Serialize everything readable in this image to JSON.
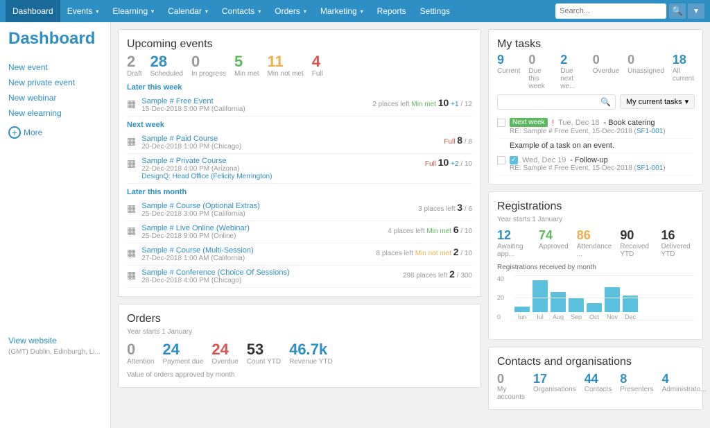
{
  "nav": {
    "items": [
      {
        "label": "Dashboard",
        "active": true
      },
      {
        "label": "Events",
        "dropdown": true
      },
      {
        "label": "Elearning",
        "dropdown": true
      },
      {
        "label": "Calendar",
        "dropdown": true
      },
      {
        "label": "Contacts",
        "dropdown": true
      },
      {
        "label": "Orders",
        "dropdown": true
      },
      {
        "label": "Marketing",
        "dropdown": true
      },
      {
        "label": "Reports",
        "dropdown": false
      },
      {
        "label": "Settings",
        "dropdown": false
      }
    ],
    "search_placeholder": "Search..."
  },
  "sidebar": {
    "title": "Dashboard",
    "links": [
      {
        "label": "New event"
      },
      {
        "label": "New private event"
      },
      {
        "label": "New webinar"
      },
      {
        "label": "New elearning"
      }
    ],
    "more_label": "More",
    "footer": "(GMT) Dublin, Edinburgh, Li..."
  },
  "upcoming_events": {
    "title": "Upcoming events",
    "stats": [
      {
        "number": "2",
        "label": "Draft",
        "color": "gray"
      },
      {
        "number": "28",
        "label": "Scheduled",
        "color": "blue"
      },
      {
        "number": "0",
        "label": "In progress",
        "color": "gray"
      },
      {
        "number": "5",
        "label": "Min met",
        "color": "green"
      },
      {
        "number": "11",
        "label": "Min not met",
        "color": "orange"
      },
      {
        "number": "4",
        "label": "Full",
        "color": "red"
      }
    ],
    "sections": [
      {
        "header": "Later this week",
        "events": [
          {
            "name": "Sample # Free Event",
            "datetime": "15-Dec-2018 5:00 PM (California)",
            "status": "",
            "places_text": "2 places left",
            "status_label": "Min met",
            "status_color": "green",
            "count": "10",
            "plus": "+1",
            "total": "12"
          }
        ]
      },
      {
        "header": "Next week",
        "events": [
          {
            "name": "Sample # Paid Course",
            "datetime": "20-Dec-2018 1:00 PM (Chicago)",
            "status_label": "Full",
            "status_color": "red",
            "count": "8",
            "plus": "",
            "total": "8",
            "places_text": ""
          },
          {
            "name": "Sample # Private Course",
            "datetime": "22-Dec-2018 4:00 PM (Arizona)",
            "location": "DesignQ: Head Office (Felicity Merrington)",
            "status_label": "Full",
            "status_color": "red",
            "count": "10",
            "plus": "+2",
            "total": "10",
            "places_text": ""
          }
        ]
      },
      {
        "header": "Later this month",
        "events": [
          {
            "name": "Sample # Course (Optional Extras)",
            "datetime": "25-Dec-2018 3:00 PM (California)",
            "places_text": "3 places left",
            "status_label": "",
            "count": "3",
            "total": "6"
          },
          {
            "name": "Sample # Live Online (Webinar)",
            "datetime": "25-Dec-2018 9:00 PM (Online)",
            "places_text": "4 places left",
            "status_label": "Min met",
            "status_color": "green",
            "count": "6",
            "total": "10"
          },
          {
            "name": "Sample # Course (Multi-Session)",
            "datetime": "27-Dec-2018 1:00 AM (California)",
            "places_text": "8 places left",
            "status_label": "Min not met",
            "status_color": "orange",
            "count": "2",
            "total": "10"
          },
          {
            "name": "Sample # Conference (Choice Of Sessions)",
            "datetime": "28-Dec-2018 4:00 PM (Chicago)",
            "places_text": "298 places left",
            "count": "2",
            "total": "300"
          }
        ]
      }
    ]
  },
  "orders": {
    "title": "Orders",
    "subtitle": "Year starts 1 January",
    "stats": [
      {
        "number": "0",
        "label": "Attention",
        "color": "gray"
      },
      {
        "number": "24",
        "label": "Payment due",
        "color": "blue"
      },
      {
        "number": "24",
        "label": "Overdue",
        "color": "red"
      },
      {
        "number": "53",
        "label": "Count YTD",
        "color": "dark"
      },
      {
        "number": "46.7k",
        "label": "Revenue YTD",
        "color": "blue"
      }
    ],
    "chart_note": "Value of orders approved by month"
  },
  "my_tasks": {
    "title": "My tasks",
    "stats": [
      {
        "number": "9",
        "label": "Current",
        "color": "blue"
      },
      {
        "number": "0",
        "label": "Due this week",
        "color": "gray"
      },
      {
        "number": "2",
        "label": "Due next we...",
        "color": "blue"
      },
      {
        "number": "0",
        "label": "Overdue",
        "color": "gray"
      },
      {
        "number": "0",
        "label": "Unassigned",
        "color": "gray"
      },
      {
        "number": "18",
        "label": "All current",
        "color": "blue"
      }
    ],
    "filter_label": "My current tasks",
    "tasks": [
      {
        "week_label": "Next week",
        "date": "Tue, Dec 18",
        "title": "- Book catering",
        "sub": "RE: Sample # Free Event, 15-Dec-2018 (SF1-001)",
        "has_alert": true
      },
      {
        "title": "Example of a task on an event.",
        "sub": "",
        "has_alert": false
      },
      {
        "date": "Wed, Dec 19",
        "title": "- Follow-up",
        "sub": "RE: Sample # Free Event, 15-Dec-2018 (SF1-001)",
        "has_alert": false
      }
    ]
  },
  "registrations": {
    "title": "Registrations",
    "subtitle": "Year starts 1 January",
    "stats": [
      {
        "number": "12",
        "label": "Awaiting app...",
        "color": "blue"
      },
      {
        "number": "74",
        "label": "Approved",
        "color": "green"
      },
      {
        "number": "86",
        "label": "Attendance ...",
        "color": "orange"
      },
      {
        "number": "90",
        "label": "Received YTD",
        "color": "dark"
      },
      {
        "number": "16",
        "label": "Delivered YTD",
        "color": "dark"
      }
    ],
    "chart_title": "Registrations received by month",
    "chart_max": 40,
    "chart_bars": [
      {
        "label": "Iun",
        "value": 5
      },
      {
        "label": "Iul",
        "value": 28
      },
      {
        "label": "Aug",
        "value": 18
      },
      {
        "label": "Sep",
        "value": 12
      },
      {
        "label": "Oct",
        "value": 8
      },
      {
        "label": "Nov",
        "value": 22
      },
      {
        "label": "Dec",
        "value": 15
      }
    ]
  },
  "contacts": {
    "title": "Contacts and organisations",
    "stats": [
      {
        "number": "0",
        "label": "My accounts",
        "color": "gray"
      },
      {
        "number": "17",
        "label": "Organisations",
        "color": "blue"
      },
      {
        "number": "44",
        "label": "Contacts",
        "color": "blue"
      },
      {
        "number": "8",
        "label": "Presenters",
        "color": "blue"
      },
      {
        "number": "4",
        "label": "Administrato...",
        "color": "blue"
      }
    ]
  }
}
